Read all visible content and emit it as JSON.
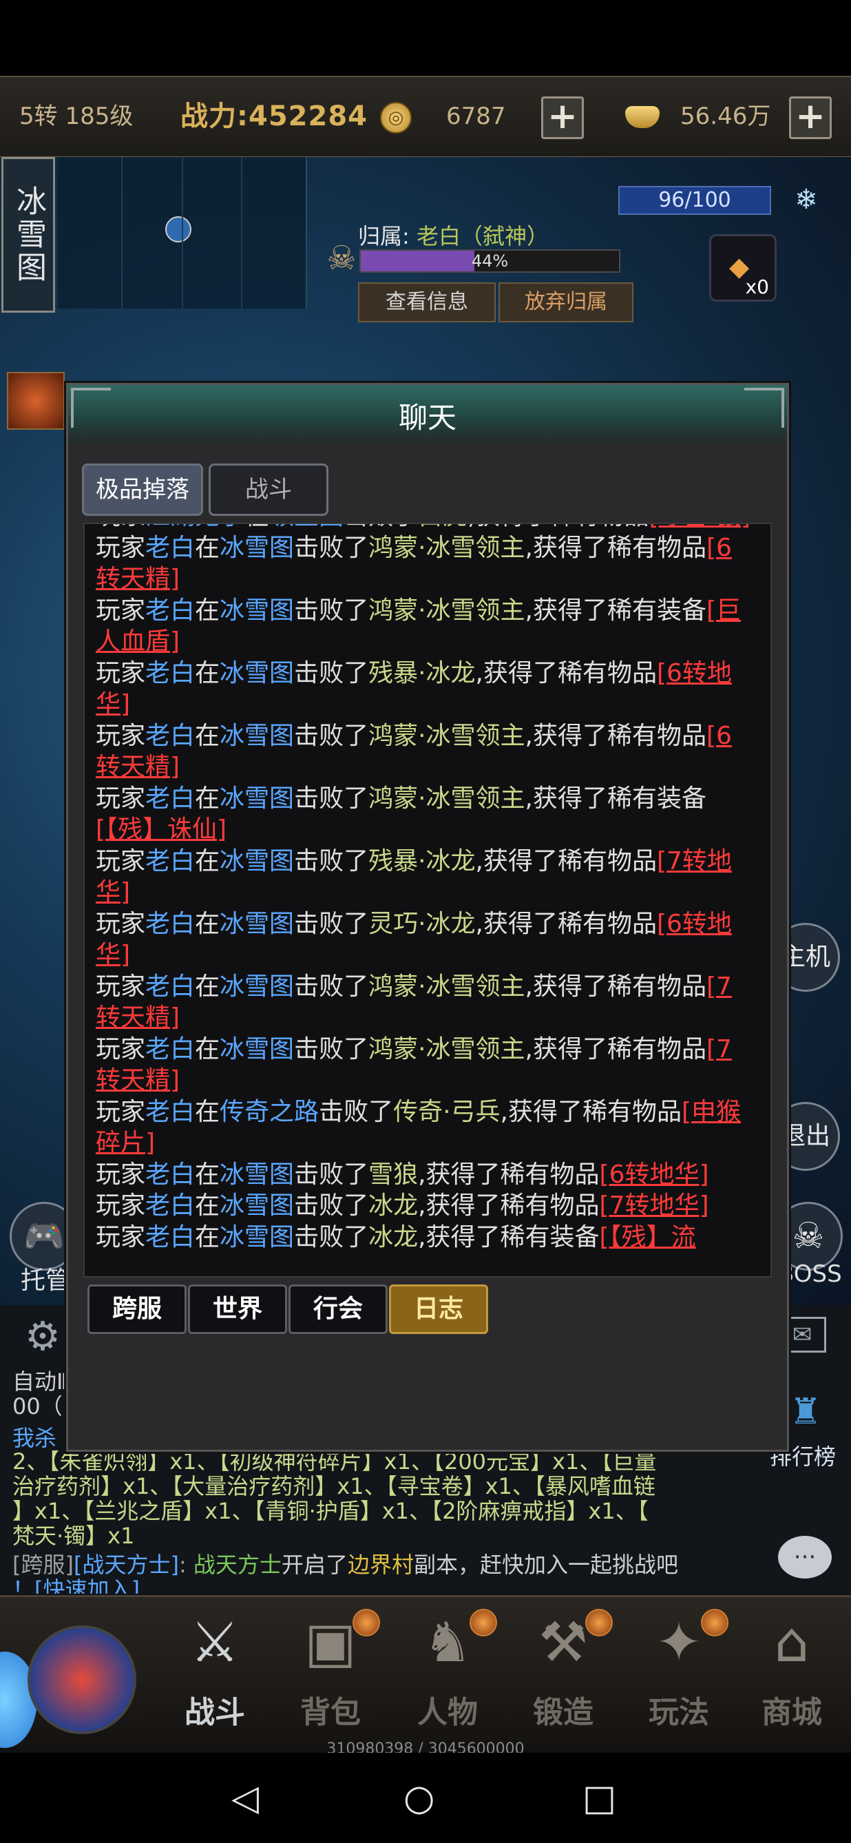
{
  "topbar": {
    "level": "5转 185级",
    "power": "战力:452284",
    "gold": "6787",
    "ingot": "56.46万",
    "plus": "+"
  },
  "scene": {
    "map_name": "冰雪图",
    "hp": "96/100",
    "owner_prefix": "归属:",
    "owner_name": "老白（弑神）",
    "owner_progress_label": "44%",
    "owner_progress": 0.44,
    "btn_view": "查看信息",
    "btn_abandon": "放弃归属",
    "item_count": "x0",
    "left_label": "托管",
    "right_top_label": "主机",
    "right_exit_label": "退出",
    "boss_label": "BOSS"
  },
  "chat": {
    "title": "聊天",
    "tabs": [
      {
        "label": "极品掉落",
        "active": true
      },
      {
        "label": "战斗",
        "active": false
      }
    ],
    "log_clip_top": [
      {
        "segments": [
          {
            "t": "玩家",
            "c": "c-player"
          },
          {
            "t": "江湖鬼子",
            "c": "c-name"
          },
          {
            "t": "在",
            "c": "c-player"
          },
          {
            "t": "领主图",
            "c": "c-place"
          },
          {
            "t": "击败了",
            "c": "c-verb"
          },
          {
            "t": "白虎",
            "c": "c-monster"
          },
          {
            "t": ",获得了稀有物品",
            "c": "c-verb"
          },
          {
            "t": "[冰雪·鼠]",
            "c": "c-item"
          }
        ]
      }
    ],
    "log": [
      {
        "segments": [
          {
            "t": "玩家",
            "c": "c-player"
          },
          {
            "t": "老白",
            "c": "c-name"
          },
          {
            "t": "在",
            "c": "c-player"
          },
          {
            "t": "冰雪图",
            "c": "c-place"
          },
          {
            "t": "击败了",
            "c": "c-verb"
          },
          {
            "t": "鸿蒙·冰雪领主",
            "c": "c-monster"
          },
          {
            "t": ",获得了稀有物品",
            "c": "c-verb"
          },
          {
            "t": "[6转天精]",
            "c": "c-item"
          }
        ]
      },
      {
        "segments": [
          {
            "t": "玩家",
            "c": "c-player"
          },
          {
            "t": "老白",
            "c": "c-name"
          },
          {
            "t": "在",
            "c": "c-player"
          },
          {
            "t": "冰雪图",
            "c": "c-place"
          },
          {
            "t": "击败了",
            "c": "c-verb"
          },
          {
            "t": "鸿蒙·冰雪领主",
            "c": "c-monster"
          },
          {
            "t": ",获得了稀有装备",
            "c": "c-verb"
          },
          {
            "t": "[巨人血盾]",
            "c": "c-item"
          }
        ]
      },
      {
        "segments": [
          {
            "t": "玩家",
            "c": "c-player"
          },
          {
            "t": "老白",
            "c": "c-name"
          },
          {
            "t": "在",
            "c": "c-player"
          },
          {
            "t": "冰雪图",
            "c": "c-place"
          },
          {
            "t": "击败了",
            "c": "c-verb"
          },
          {
            "t": "残暴·冰龙",
            "c": "c-monster"
          },
          {
            "t": ",获得了稀有物品",
            "c": "c-verb"
          },
          {
            "t": "[6转地华]",
            "c": "c-item"
          }
        ]
      },
      {
        "segments": [
          {
            "t": "玩家",
            "c": "c-player"
          },
          {
            "t": "老白",
            "c": "c-name"
          },
          {
            "t": "在",
            "c": "c-player"
          },
          {
            "t": "冰雪图",
            "c": "c-place"
          },
          {
            "t": "击败了",
            "c": "c-verb"
          },
          {
            "t": "鸿蒙·冰雪领主",
            "c": "c-monster"
          },
          {
            "t": ",获得了稀有物品",
            "c": "c-verb"
          },
          {
            "t": "[6转天精]",
            "c": "c-item"
          }
        ]
      },
      {
        "segments": [
          {
            "t": "玩家",
            "c": "c-player"
          },
          {
            "t": "老白",
            "c": "c-name"
          },
          {
            "t": "在",
            "c": "c-player"
          },
          {
            "t": "冰雪图",
            "c": "c-place"
          },
          {
            "t": "击败了",
            "c": "c-verb"
          },
          {
            "t": "鸿蒙·冰雪领主",
            "c": "c-monster"
          },
          {
            "t": ",获得了稀有装备",
            "c": "c-verb"
          },
          {
            "t": "[【残】诛仙]",
            "c": "c-item"
          }
        ]
      },
      {
        "segments": [
          {
            "t": "玩家",
            "c": "c-player"
          },
          {
            "t": "老白",
            "c": "c-name"
          },
          {
            "t": "在",
            "c": "c-player"
          },
          {
            "t": "冰雪图",
            "c": "c-place"
          },
          {
            "t": "击败了",
            "c": "c-verb"
          },
          {
            "t": "残暴·冰龙",
            "c": "c-monster"
          },
          {
            "t": ",获得了稀有物品",
            "c": "c-verb"
          },
          {
            "t": "[7转地华]",
            "c": "c-item"
          }
        ]
      },
      {
        "segments": [
          {
            "t": "玩家",
            "c": "c-player"
          },
          {
            "t": "老白",
            "c": "c-name"
          },
          {
            "t": "在",
            "c": "c-player"
          },
          {
            "t": "冰雪图",
            "c": "c-place"
          },
          {
            "t": "击败了",
            "c": "c-verb"
          },
          {
            "t": "灵巧·冰龙",
            "c": "c-monster"
          },
          {
            "t": ",获得了稀有物品",
            "c": "c-verb"
          },
          {
            "t": "[6转地华]",
            "c": "c-item"
          }
        ]
      },
      {
        "segments": [
          {
            "t": "玩家",
            "c": "c-player"
          },
          {
            "t": "老白",
            "c": "c-name"
          },
          {
            "t": "在",
            "c": "c-player"
          },
          {
            "t": "冰雪图",
            "c": "c-place"
          },
          {
            "t": "击败了",
            "c": "c-verb"
          },
          {
            "t": "鸿蒙·冰雪领主",
            "c": "c-monster"
          },
          {
            "t": ",获得了稀有物品",
            "c": "c-verb"
          },
          {
            "t": "[7转天精]",
            "c": "c-item"
          }
        ]
      },
      {
        "segments": [
          {
            "t": "玩家",
            "c": "c-player"
          },
          {
            "t": "老白",
            "c": "c-name"
          },
          {
            "t": "在",
            "c": "c-player"
          },
          {
            "t": "冰雪图",
            "c": "c-place"
          },
          {
            "t": "击败了",
            "c": "c-verb"
          },
          {
            "t": "鸿蒙·冰雪领主",
            "c": "c-monster"
          },
          {
            "t": ",获得了稀有物品",
            "c": "c-verb"
          },
          {
            "t": "[7转天精]",
            "c": "c-item"
          }
        ]
      },
      {
        "segments": [
          {
            "t": "玩家",
            "c": "c-player"
          },
          {
            "t": "老白",
            "c": "c-name"
          },
          {
            "t": "在",
            "c": "c-player"
          },
          {
            "t": "传奇之路",
            "c": "c-place"
          },
          {
            "t": "击败了",
            "c": "c-verb"
          },
          {
            "t": "传奇·弓兵",
            "c": "c-monster"
          },
          {
            "t": ",获得了稀有物品",
            "c": "c-verb"
          },
          {
            "t": "[申猴碎片]",
            "c": "c-item"
          }
        ]
      },
      {
        "segments": [
          {
            "t": "玩家",
            "c": "c-player"
          },
          {
            "t": "老白",
            "c": "c-name"
          },
          {
            "t": "在",
            "c": "c-player"
          },
          {
            "t": "冰雪图",
            "c": "c-place"
          },
          {
            "t": "击败了",
            "c": "c-verb"
          },
          {
            "t": "雪狼",
            "c": "c-monster"
          },
          {
            "t": ",获得了稀有物品",
            "c": "c-verb"
          },
          {
            "t": "[6转地华]",
            "c": "c-item"
          }
        ]
      },
      {
        "segments": [
          {
            "t": "玩家",
            "c": "c-player"
          },
          {
            "t": "老白",
            "c": "c-name"
          },
          {
            "t": "在",
            "c": "c-player"
          },
          {
            "t": "冰雪图",
            "c": "c-place"
          },
          {
            "t": "击败了",
            "c": "c-verb"
          },
          {
            "t": "冰龙",
            "c": "c-monster"
          },
          {
            "t": ",获得了稀有物品",
            "c": "c-verb"
          },
          {
            "t": "[7转地华]",
            "c": "c-item"
          }
        ]
      },
      {
        "segments": [
          {
            "t": "玩家",
            "c": "c-player"
          },
          {
            "t": "老白",
            "c": "c-name"
          },
          {
            "t": "在",
            "c": "c-player"
          },
          {
            "t": "冰雪图",
            "c": "c-place"
          },
          {
            "t": "击败了",
            "c": "c-verb"
          },
          {
            "t": "冰龙",
            "c": "c-monster"
          },
          {
            "t": ",获得了稀有装备",
            "c": "c-verb"
          },
          {
            "t": "[【残】流",
            "c": "c-item"
          }
        ]
      }
    ],
    "bottom_tabs": [
      {
        "label": "跨服",
        "active": false
      },
      {
        "label": "世界",
        "active": false
      },
      {
        "label": "行会",
        "active": false
      },
      {
        "label": "日志",
        "active": true
      }
    ]
  },
  "strip": {
    "line1": "自动Ⅱ",
    "line2": "00（",
    "line3_prefix": "我杀",
    "drops_line1": "2、【朱雀炽翎】x1、【初级神符碎片】x1、【200元宝】x1、【巨量",
    "drops_line2": "治疗药剂】x1、【大量治疗药剂】x1、【寻宝卷】x1、【暴风嗜血链",
    "drops_line3": "】x1、【兰兆之盾】x1、【青铜·护盾】x1、【2阶麻痹戒指】x1、【",
    "drops_line4": "梵天·镯】x1",
    "cross_tag": "[跨服]",
    "cross_name": "[战天方士]",
    "cross_sep": ":",
    "cross_name2": "战天方士",
    "cross_text1": "开启了",
    "cross_place": "边界村",
    "cross_text2": "副本，赶快加入一起挑战吧",
    "cross_join": "！[快速加入]",
    "rank_label": "排行榜"
  },
  "nav": {
    "items": [
      {
        "label": "战斗",
        "icon": "crossed-swords-icon",
        "active": true,
        "dot": false
      },
      {
        "label": "背包",
        "icon": "backpack-icon",
        "active": false,
        "dot": true
      },
      {
        "label": "人物",
        "icon": "helmet-icon",
        "active": false,
        "dot": true
      },
      {
        "label": "锻造",
        "icon": "anvil-icon",
        "active": false,
        "dot": true
      },
      {
        "label": "玩法",
        "icon": "sword-wing-icon",
        "active": false,
        "dot": true
      },
      {
        "label": "商城",
        "icon": "pavilion-icon",
        "active": false,
        "dot": false
      }
    ],
    "exp": "310980398 / 3045600000"
  },
  "colors": {
    "item_red": "#ff3a3a",
    "name_blue": "#5aa7ff",
    "monster_olive": "#c8d88a",
    "active_tab_gold": "#8a6418"
  }
}
